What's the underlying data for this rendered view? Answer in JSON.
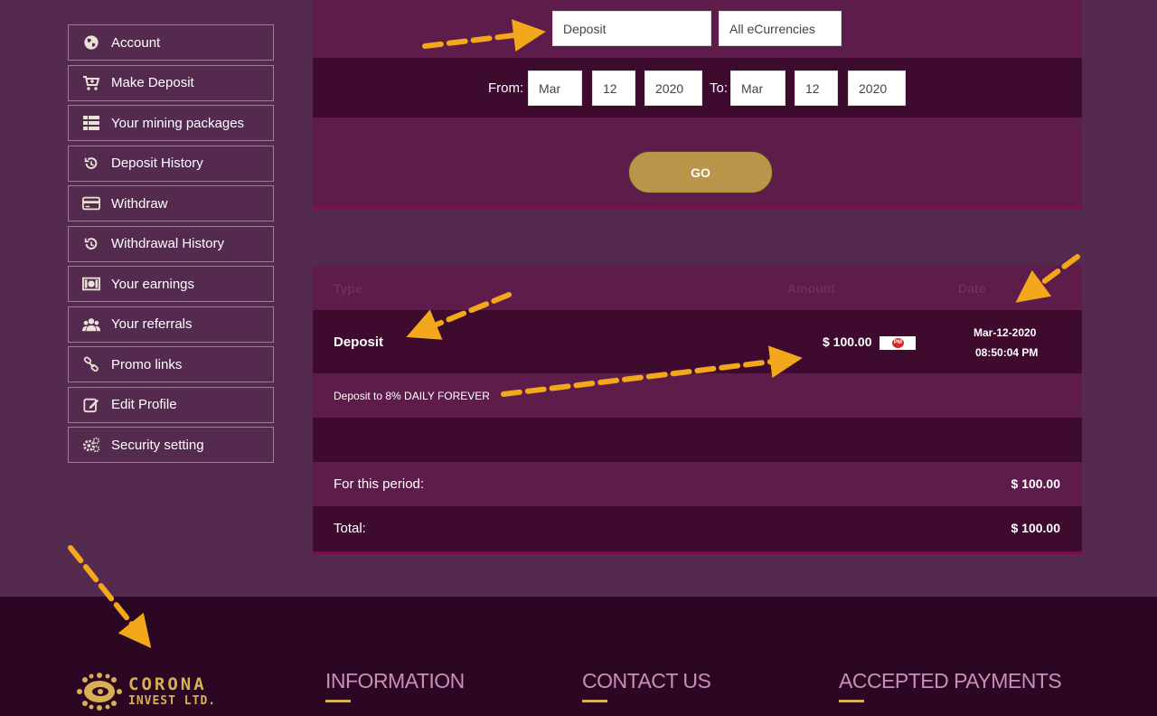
{
  "sidebar": {
    "items": [
      {
        "label": "Account",
        "icon": "globe-icon"
      },
      {
        "label": "Make Deposit",
        "icon": "cart-icon"
      },
      {
        "label": "Your mining packages",
        "icon": "list-icon"
      },
      {
        "label": "Deposit History",
        "icon": "history-icon"
      },
      {
        "label": "Withdraw",
        "icon": "credit-card-icon"
      },
      {
        "label": "Withdrawal History",
        "icon": "history-icon"
      },
      {
        "label": "Your earnings",
        "icon": "money-icon"
      },
      {
        "label": "Your referrals",
        "icon": "users-icon"
      },
      {
        "label": "Promo links",
        "icon": "link-icon"
      },
      {
        "label": "Edit Profile",
        "icon": "edit-icon"
      },
      {
        "label": "Security setting",
        "icon": "gears-icon"
      }
    ]
  },
  "filters": {
    "type_select": "Deposit",
    "currency_select": "All eCurrencies",
    "from_label": "From:",
    "to_label": "To:",
    "from_month": "Mar",
    "from_day": "12",
    "from_year": "2020",
    "to_month": "Mar",
    "to_day": "12",
    "to_year": "2020",
    "go_label": "GO"
  },
  "results": {
    "headers": {
      "type": "Type",
      "amount": "Amount",
      "date": "Date"
    },
    "row": {
      "type": "Deposit",
      "amount": "$ 100.00",
      "payment_badge": "PM",
      "date": "Mar-12-2020",
      "time": "08:50:04 PM",
      "description": "Deposit to 8% DAILY FOREVER"
    },
    "period_label": "For this period:",
    "period_value": "$ 100.00",
    "total_label": "Total:",
    "total_value": "$ 100.00"
  },
  "footer": {
    "logo_line1": "CORONA",
    "logo_line2": "INVEST LTD.",
    "information": "INFORMATION",
    "contact": "CONTACT US",
    "payments": "ACCEPTED PAYMENTS"
  },
  "colors": {
    "background": "#542a4e",
    "panel": "#5e1c4a",
    "panel_dark": "#3e0b2f",
    "gold": "#b8954a",
    "arrow": "#f3a81c",
    "footer": "#2c0723"
  }
}
